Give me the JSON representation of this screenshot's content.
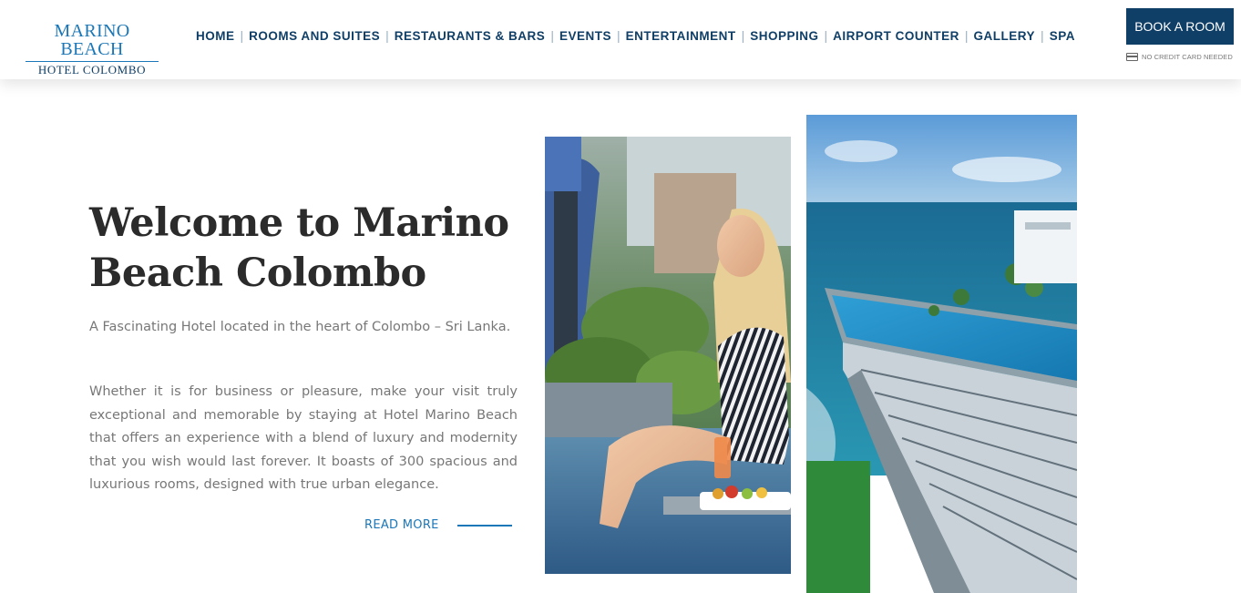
{
  "brand": {
    "name": "MARINO BEACH",
    "sub": "HOTEL COLOMBO"
  },
  "nav": {
    "items": [
      {
        "label": "HOME"
      },
      {
        "label": "ROOMS AND SUITES"
      },
      {
        "label": "RESTAURANTS & BARS"
      },
      {
        "label": "EVENTS"
      },
      {
        "label": "ENTERTAINMENT"
      },
      {
        "label": "SHOPPING"
      },
      {
        "label": "AIRPORT COUNTER"
      },
      {
        "label": "GALLERY"
      },
      {
        "label": "SPA"
      }
    ],
    "separator": "|"
  },
  "booking": {
    "button_label": "BOOK A ROOM",
    "note": "NO CREDIT CARD NEEDED",
    "note_icon": "credit-card-icon"
  },
  "welcome": {
    "title": "Welcome to Marino Beach Colombo",
    "intro": "A Fascinating Hotel located in the heart of Colombo – Sri Lanka.",
    "body": "Whether it is for business or pleasure, make your visit truly exceptional and memorable by staying at Hotel Marino Beach that offers an experience with a blend of luxury and modernity that you wish would last forever. It boasts of 300 spacious and luxurious rooms, designed with true urban elegance.",
    "read_more": "READ MORE"
  },
  "colors": {
    "navy": "#0f3e66",
    "accent_blue": "#1b77b7",
    "body_text": "#777777",
    "title_text": "#2b2b2b"
  }
}
